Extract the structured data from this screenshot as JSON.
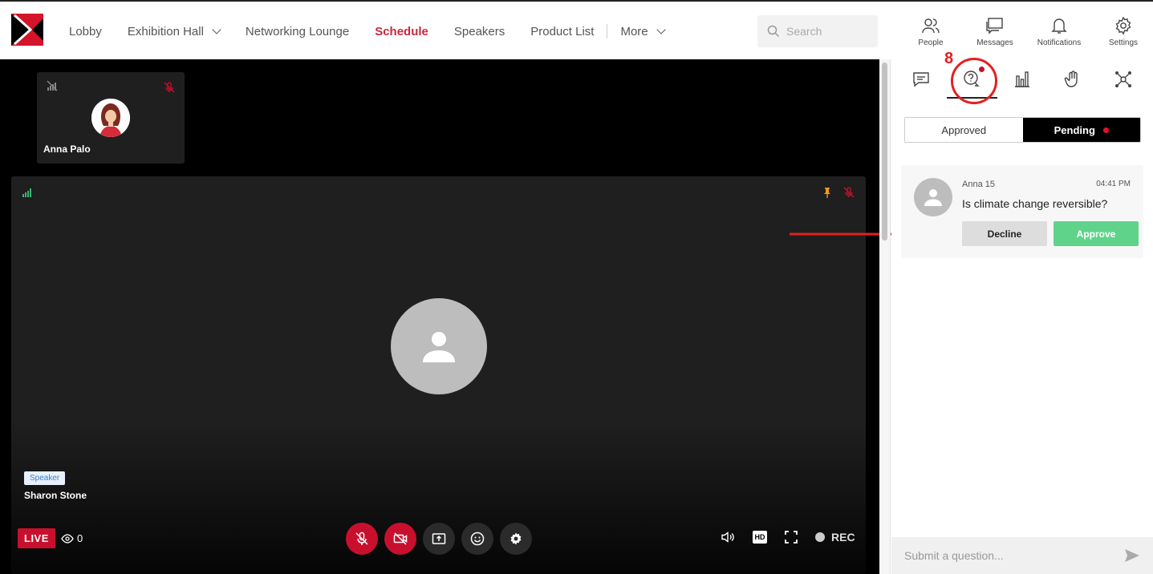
{
  "nav": {
    "items": [
      {
        "label": "Lobby",
        "dropdown": false,
        "active": false
      },
      {
        "label": "Exhibition Hall",
        "dropdown": true,
        "active": false
      },
      {
        "label": "Networking Lounge",
        "dropdown": false,
        "active": false
      },
      {
        "label": "Schedule",
        "dropdown": false,
        "active": true
      },
      {
        "label": "Speakers",
        "dropdown": false,
        "active": false
      },
      {
        "label": "Product List",
        "dropdown": false,
        "active": false
      },
      {
        "label": "More",
        "dropdown": true,
        "active": false
      }
    ],
    "search_placeholder": "Search"
  },
  "top_icons": [
    {
      "label": "People",
      "icon": "people-icon"
    },
    {
      "label": "Messages",
      "icon": "messages-icon"
    },
    {
      "label": "Notifications",
      "icon": "bell-icon"
    },
    {
      "label": "Settings",
      "icon": "gear-icon"
    }
  ],
  "stage": {
    "thumbnail": {
      "name": "Anna Palo"
    },
    "main_tile": {
      "badge": "Speaker",
      "name": "Sharon Stone"
    },
    "live_label": "LIVE",
    "viewer_count": "0",
    "quality_label": "HD",
    "rec_label": "REC"
  },
  "panel": {
    "callout_number": "8",
    "segments": {
      "approved": "Approved",
      "pending": "Pending"
    },
    "question": {
      "user": "Anna 15",
      "time": "04:41 PM",
      "text": "Is climate change reversible?",
      "decline_label": "Decline",
      "approve_label": "Approve"
    },
    "submit_placeholder": "Submit a question..."
  },
  "colors": {
    "accent": "#c8283d",
    "live": "#c8102e",
    "approve": "#5fd38a",
    "annotation": "#e32020"
  }
}
